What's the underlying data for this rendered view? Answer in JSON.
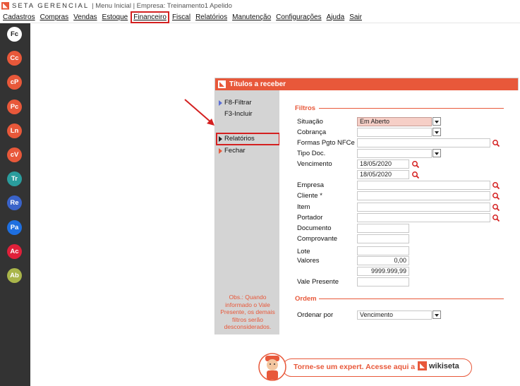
{
  "titlebar": {
    "brand": "SETA GERENCIAL",
    "context": "| Menu Inicial | Empresa: Treinamento1 Apelido"
  },
  "menu": [
    "Cadastros",
    "Compras",
    "Vendas",
    "Estoque",
    "Financeiro",
    "Fiscal",
    "Relatórios",
    "Manutenção",
    "Configurações",
    "Ajuda",
    "Sair"
  ],
  "menu_highlighted": "Financeiro",
  "sidebar": [
    {
      "label": "Fc",
      "color": "#ffffff",
      "text": "#222222"
    },
    {
      "label": "Cc",
      "color": "#e8583a",
      "text": "#ffffff"
    },
    {
      "label": "cP",
      "color": "#e8583a",
      "text": "#ffffff"
    },
    {
      "label": "Pc",
      "color": "#e8583a",
      "text": "#ffffff"
    },
    {
      "label": "Ln",
      "color": "#e8583a",
      "text": "#ffffff"
    },
    {
      "label": "cV",
      "color": "#e8583a",
      "text": "#ffffff"
    },
    {
      "label": "Tr",
      "color": "#2a9d9d",
      "text": "#ffffff"
    },
    {
      "label": "Re",
      "color": "#3a63c9",
      "text": "#ffffff"
    },
    {
      "label": "Pa",
      "color": "#1e6fe0",
      "text": "#ffffff"
    },
    {
      "label": "Ac",
      "color": "#e0203a",
      "text": "#ffffff"
    },
    {
      "label": "Ab",
      "color": "#a9b54a",
      "text": "#ffffff"
    }
  ],
  "window": {
    "title": "Títulos a receber",
    "actions": {
      "filtrar": "F8-Filtrar",
      "incluir": "F3-Incluir",
      "relatorios": "Relatórios",
      "fechar": "Fechar"
    },
    "obs": "Obs.: Quando informado o Vale Presente, os demais filtros serão desconsiderados.",
    "filtros_title": "Filtros",
    "labels": {
      "situacao": "Situação",
      "cobranca": "Cobrança",
      "formas": "Formas Pgto NFCe",
      "tipo_doc": "Tipo Doc.",
      "vencimento": "Vencimento",
      "empresa": "Empresa",
      "cliente": "Cliente *",
      "item": "Item",
      "portador": "Portador",
      "documento": "Documento",
      "comprovante": "Comprovante",
      "lote": "Lote",
      "valores": "Valores",
      "vale": "Vale Presente",
      "ordenar": "Ordenar por"
    },
    "values": {
      "situacao": "Em Aberto",
      "venc_de": "18/05/2020",
      "venc_ate": "18/05/2020",
      "valor_min": "0,00",
      "valor_max": "9999.999,99",
      "ordenar": "Vencimento"
    },
    "ordem_title": "Ordem"
  },
  "banner": {
    "text": "Torne-se um expert. Acesse aqui a",
    "brand": "wikiseta"
  }
}
